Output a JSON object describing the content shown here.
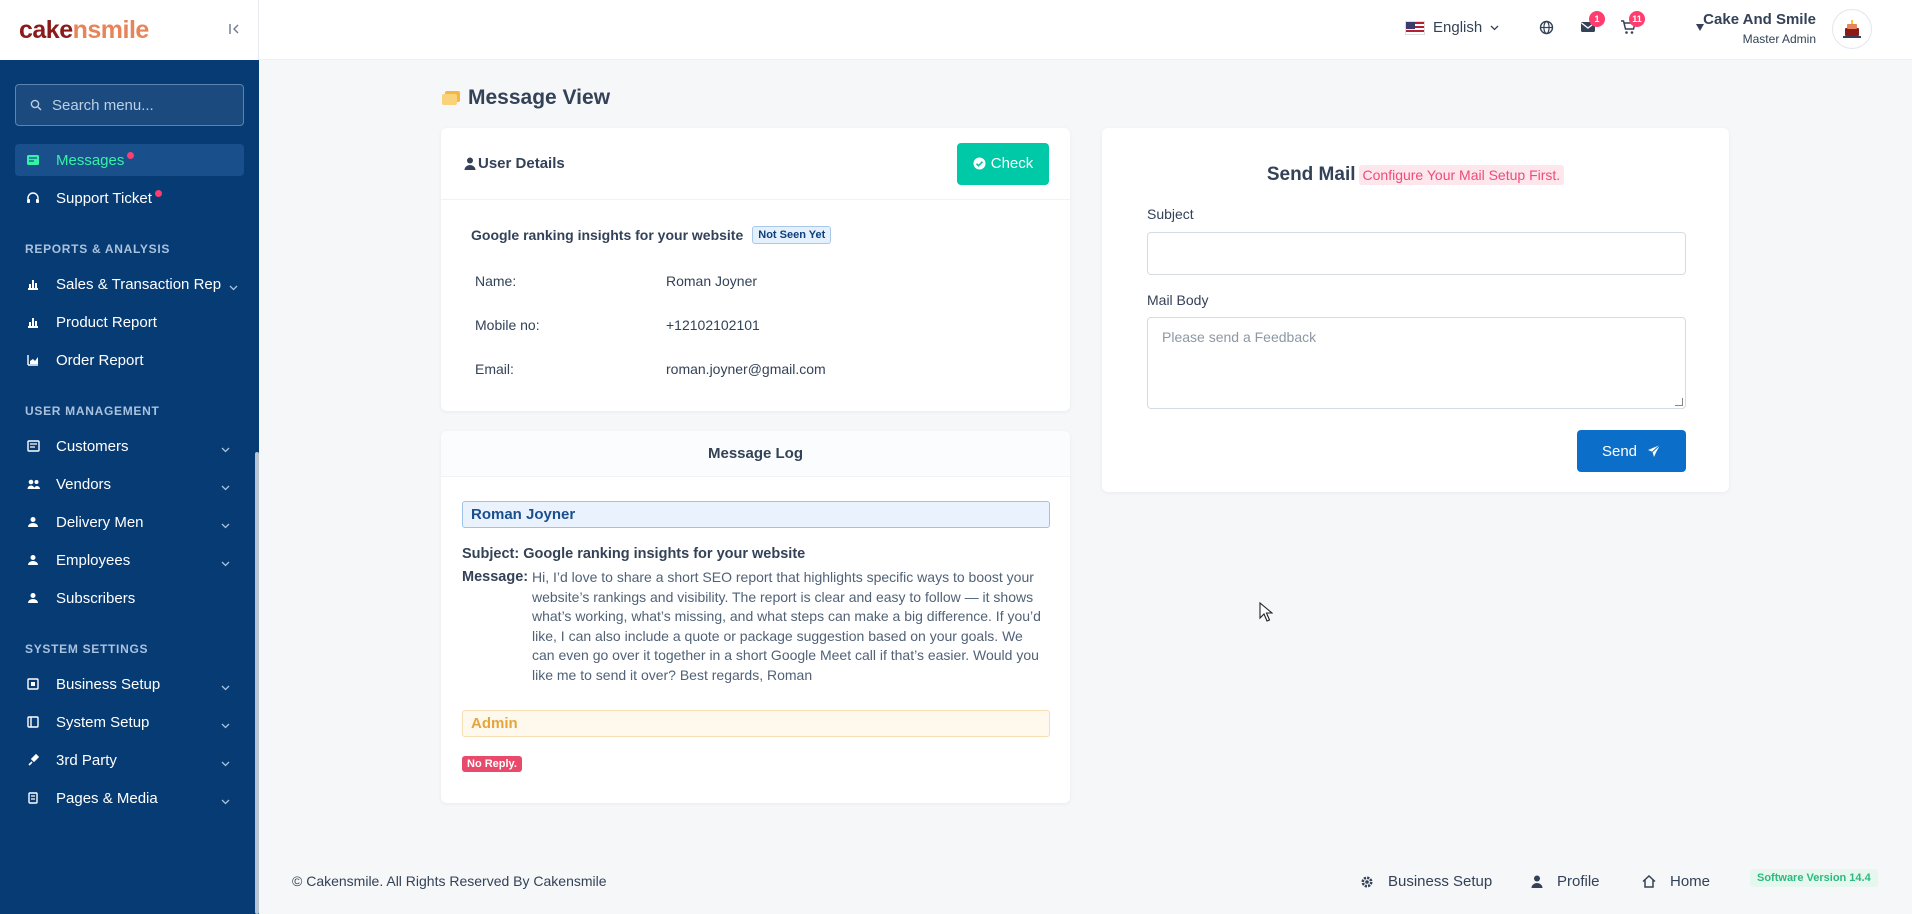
{
  "brand": {
    "logo_part1": "cake",
    "logo_part2": "nsmile"
  },
  "sidebar": {
    "search_placeholder": "Search menu...",
    "items_top": [
      {
        "label": "Messages",
        "icon": "message-icon",
        "active": true,
        "dot": true
      },
      {
        "label": "Support Ticket",
        "icon": "headset-icon",
        "active": false,
        "dot": true
      }
    ],
    "sections": [
      {
        "title": "REPORTS & ANALYSIS",
        "items": [
          {
            "label": "Sales & Transaction Rep",
            "icon": "bar-chart-icon",
            "chevron": true
          },
          {
            "label": "Product Report",
            "icon": "bar-chart-icon",
            "chevron": false
          },
          {
            "label": "Order Report",
            "icon": "chart-area-icon",
            "chevron": false
          }
        ]
      },
      {
        "title": "USER MANAGEMENT",
        "items": [
          {
            "label": "Customers",
            "icon": "customers-icon",
            "chevron": true
          },
          {
            "label": "Vendors",
            "icon": "vendors-icon",
            "chevron": true
          },
          {
            "label": "Delivery Men",
            "icon": "user-icon",
            "chevron": true
          },
          {
            "label": "Employees",
            "icon": "user-icon",
            "chevron": true
          },
          {
            "label": "Subscribers",
            "icon": "user-icon",
            "chevron": false
          }
        ]
      },
      {
        "title": "SYSTEM SETTINGS",
        "items": [
          {
            "label": "Business Setup",
            "icon": "business-icon",
            "chevron": true
          },
          {
            "label": "System Setup",
            "icon": "system-icon",
            "chevron": true
          },
          {
            "label": "3rd Party",
            "icon": "plug-icon",
            "chevron": true
          },
          {
            "label": "Pages & Media",
            "icon": "pages-icon",
            "chevron": true
          }
        ]
      }
    ]
  },
  "header": {
    "language": "English",
    "messages_badge": "1",
    "cart_badge": "11",
    "user_name": "Cake And Smile",
    "user_role": "Master Admin"
  },
  "page": {
    "title": "Message View"
  },
  "user_details": {
    "heading": "User Details",
    "check_label": "Check",
    "subject": "Google ranking insights for your website",
    "status_badge": "Not Seen Yet",
    "fields": [
      {
        "key": "Name:",
        "value": "Roman Joyner"
      },
      {
        "key": "Mobile no:",
        "value": "+12102102101"
      },
      {
        "key": "Email:",
        "value": "roman.joyner@gmail.com"
      }
    ]
  },
  "message_log": {
    "heading": "Message Log",
    "sender": "Roman Joyner",
    "subject_label": "Subject:",
    "subject": "Google ranking insights for your website",
    "message_label": "Message:",
    "message": "Hi, I’d love to share a short SEO report that highlights specific ways to boost your website’s rankings and visibility. The report is clear and easy to follow — it shows what’s working, what’s missing, and what steps can make a big difference. If you’d like, I can also include a quote or package suggestion based on your goals. We can even go over it together in a short Google Meet call if that’s easier. Would you like me to send it over? Best regards, Roman",
    "reply_from": "Admin",
    "reply_status": "No Reply."
  },
  "send_mail": {
    "title": "Send Mail",
    "warning": "Configure Your Mail Setup First.",
    "subject_label": "Subject",
    "subject_value": "",
    "body_label": "Mail Body",
    "body_placeholder": "Please send a Feedback",
    "send_label": "Send"
  },
  "footer": {
    "copyright": "© Cakensmile. All Rights Reserved By Cakensmile",
    "links": [
      "Business Setup",
      "Profile",
      "Home"
    ],
    "version": "Software Version 14.4"
  }
}
